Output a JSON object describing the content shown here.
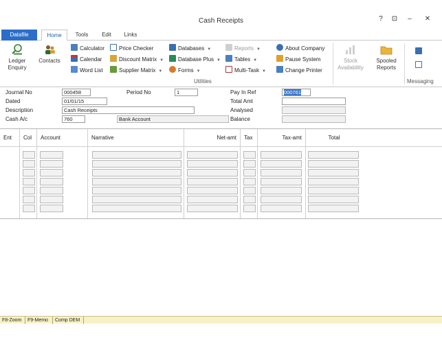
{
  "window": {
    "title": "Cash Receipts",
    "help": "?",
    "restore": "⊡",
    "minimize": "–",
    "close": "✕"
  },
  "tabs": {
    "file": "Datafile",
    "items": [
      "Home",
      "Tools",
      "Edit",
      "Links"
    ]
  },
  "ribbon": {
    "ledger_enquiry": "Ledger\nEnquiry",
    "contacts": "Contacts",
    "col1": [
      "Calculator",
      "Calendar",
      "Word List"
    ],
    "col2": [
      "Price Checker",
      "Discount Matrix",
      "Supplier Matrix"
    ],
    "col3": [
      "Databases",
      "Database Plus",
      "Forms"
    ],
    "col4": [
      "Reports",
      "Tables",
      "Multi-Task"
    ],
    "col5": [
      "About Company",
      "Pause System",
      "Change Printer"
    ],
    "stock_availability": "Stock\nAvailability",
    "spooled_reports": "Spooled\nReports",
    "utilities_label": "Utilities",
    "messaging_label": "Messaging"
  },
  "form": {
    "journal_no_label": "Journal No",
    "journal_no": "000458",
    "period_no_label": "Period No",
    "period_no": "1",
    "pay_in_ref_label": "Pay In Ref",
    "pay_in_ref": "000761",
    "dated_label": "Dated",
    "dated": "01/01/15",
    "total_amt_label": "Total Amt",
    "total_amt": "",
    "description_label": "Description",
    "description": "Cash Receipts",
    "analysed_label": "Analysed",
    "analysed": "",
    "cash_ac_label": "Cash A/c",
    "cash_ac": "760",
    "cash_ac_name": "Bank Account",
    "balance_label": "Balance",
    "balance": ""
  },
  "grid": {
    "headers": [
      "Ent",
      "Col",
      "Account",
      "Narrative",
      "Net-amt",
      "Tax",
      "Tax-amt",
      "Total"
    ]
  },
  "status": [
    "F8-Zoom",
    "F9-Memo",
    "Comp DEM",
    ""
  ]
}
